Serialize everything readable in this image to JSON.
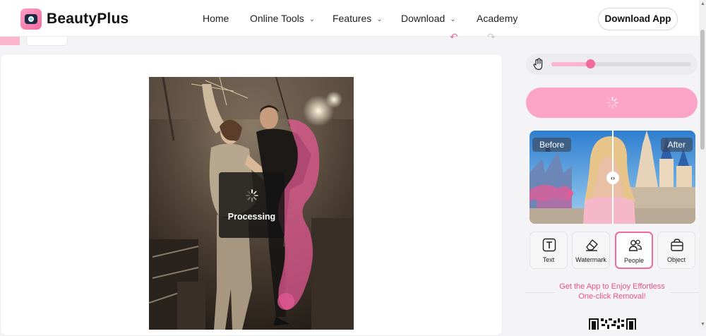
{
  "nav": {
    "brand": "BeautyPlus",
    "items": [
      {
        "label": "Home",
        "has_dropdown": false
      },
      {
        "label": "Online Tools",
        "has_dropdown": true
      },
      {
        "label": "Features",
        "has_dropdown": true
      },
      {
        "label": "Download",
        "has_dropdown": true
      },
      {
        "label": "Academy",
        "has_dropdown": false
      }
    ],
    "cta": "Download App"
  },
  "editor": {
    "processing_label": "Processing",
    "undo_icon": "undo-icon",
    "redo_icon": "redo-icon",
    "brush_size": 0.28
  },
  "preview": {
    "before_label": "Before",
    "after_label": "After",
    "handle_glyph": "‹›"
  },
  "tools": [
    {
      "label": "Text",
      "icon": "text-icon",
      "active": false
    },
    {
      "label": "Watermark",
      "icon": "eraser-icon",
      "active": false
    },
    {
      "label": "People",
      "icon": "people-icon",
      "active": true
    },
    {
      "label": "Object",
      "icon": "object-icon",
      "active": false
    }
  ],
  "promo": {
    "line1": "Get the App to Enjoy Effortless",
    "line2": "One-click Removal!"
  },
  "colors": {
    "accent": "#f06a9a",
    "button_pink": "#fba4c5",
    "light_pink": "#fbb6cd",
    "promo_text": "#ec4f86"
  }
}
